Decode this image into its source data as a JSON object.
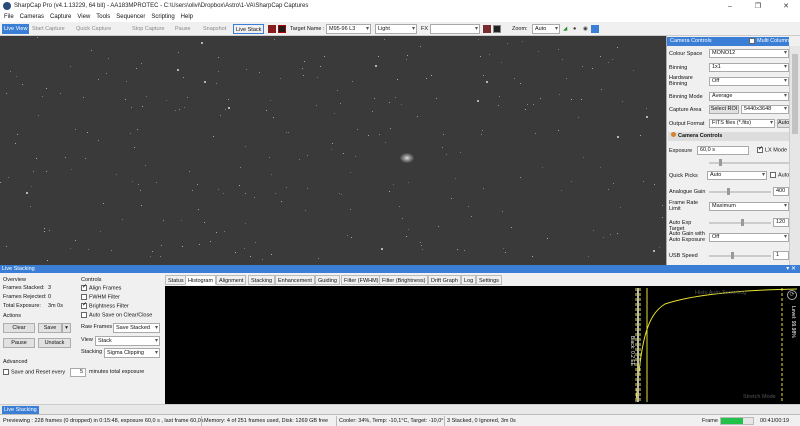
{
  "window": {
    "title": "SharpCap Pro (v4.1.13229, 64 bit) - AA183MPROTEC - C:\\Users\\olivi\\Dropbox\\Astro\\1-VA\\SharpCap Captures",
    "minimize": "–",
    "maximize": "❐",
    "close": "✕"
  },
  "menu": [
    "File",
    "Cameras",
    "Capture",
    "View",
    "Tools",
    "Sequencer",
    "Scripting",
    "Help"
  ],
  "toolbar": {
    "live_view": "Live View",
    "start_capture": "Start Capture",
    "quick_capture": "Quick Capture",
    "stop_capture": "Stop Capture",
    "pause": "Pause",
    "snapshot": "Snapshot",
    "live_stack": "Live Stack",
    "target_label": "Target Name :",
    "target_value": "M95-96 L3",
    "filter_value": "Light",
    "fx_label": "FX",
    "fx_value": "",
    "zoom_label": "Zoom:",
    "zoom_value": "Auto"
  },
  "right_panel": {
    "header": "Camera Controls",
    "multi_column": "Multi Column",
    "rows": [
      {
        "label": "Colour Space",
        "value": "MONO12"
      },
      {
        "label": "Binning",
        "value": "1x1"
      },
      {
        "label": "Hardware Binning",
        "value": "Off"
      },
      {
        "label": "Binning Mode",
        "value": "Average"
      },
      {
        "label": "Capture Area",
        "value": "5440x3648"
      },
      {
        "label": "Output Format",
        "value": "FITS files (*.fits)"
      }
    ],
    "select_roi": "Select ROI",
    "auto_label": "Auto",
    "camera_controls_header": "Camera Controls",
    "exposure_label": "Exposure",
    "exposure_value": "60,0 s",
    "lx_mode": "LX Mode",
    "quick_picks": "Quick Picks",
    "quick_picks_auto": "Auto",
    "analogue_gain_label": "Analogue Gain",
    "analogue_gain_value": "400",
    "frame_rate_label": "Frame Rate Limit",
    "frame_rate_value": "Maximum",
    "auto_exp_label": "Auto Exp Target",
    "auto_exp_value": "120",
    "auto_gain_label": "Auto Gain with Auto Exposure",
    "auto_gain_value": "Off",
    "usb_label": "USB Speed",
    "usb_value": "1"
  },
  "live_stacking": {
    "header": "Live Stacking",
    "overview_title": "Overview",
    "frames_stacked_label": "Frames Stacked:",
    "frames_stacked": "3",
    "frames_rejected_label": "Frames Rejected:",
    "frames_rejected": "0",
    "total_exposure_label": "Total Exposure:",
    "total_exposure": "3m 0s",
    "actions_title": "Actions",
    "clear": "Clear",
    "save": "Save",
    "pause": "Pause",
    "unstack": "Unstack",
    "advanced_title": "Advanced",
    "save_reset_label": "Save and Reset every",
    "save_reset_value": "5",
    "save_reset_suffix": "minutes total exposure",
    "controls_title": "Controls",
    "align_frames": "Align Frames",
    "fwhm_filter": "FWHM Filter",
    "brightness_filter": "Brightness Filter",
    "auto_save": "Auto Save on Clear/Close",
    "raw_frames_label": "Raw Frames",
    "raw_frames_value": "Save Stacked",
    "view_label": "View",
    "view_value": "Stack",
    "stacking_label": "Stacking",
    "stacking_value": "Sigma Clipping"
  },
  "tabs": [
    "Status",
    "Histogram",
    "Alignment",
    "Stacking",
    "Enhancement",
    "Guiding",
    "Filter (FWHM)",
    "Filter (Brightness)",
    "Drift Graph",
    "Log",
    "Settings"
  ],
  "histogram": {
    "toolbar": "Histo  Auto  Zoom  Log",
    "stretch_mode": "Stretch Mode",
    "level_label": "Level: 99.98%",
    "black_label": "Black: 0.2 EE"
  },
  "bottom_tab": "Live Stacking",
  "status": {
    "preview": "Previewing : 228 frames (0 dropped) in 0:15:48, exposure 60,0 s , last frame 60,0s",
    "memory": "Memory: 4 of 251 frames used, Disk: 1269 GB free",
    "cooler": "Cooler: 34%, Temp: -10,1°C, Target: -10,0°",
    "stacked": "3 Stacked, 0 Ignored, 3m 0s",
    "frame_label": "Frame",
    "frame_progress": 0.7,
    "timer": "00:41/00:19"
  },
  "colors": {
    "accent": "#3a7ed6",
    "progress": "#22c24a",
    "histo_yellow": "#e8e030"
  }
}
